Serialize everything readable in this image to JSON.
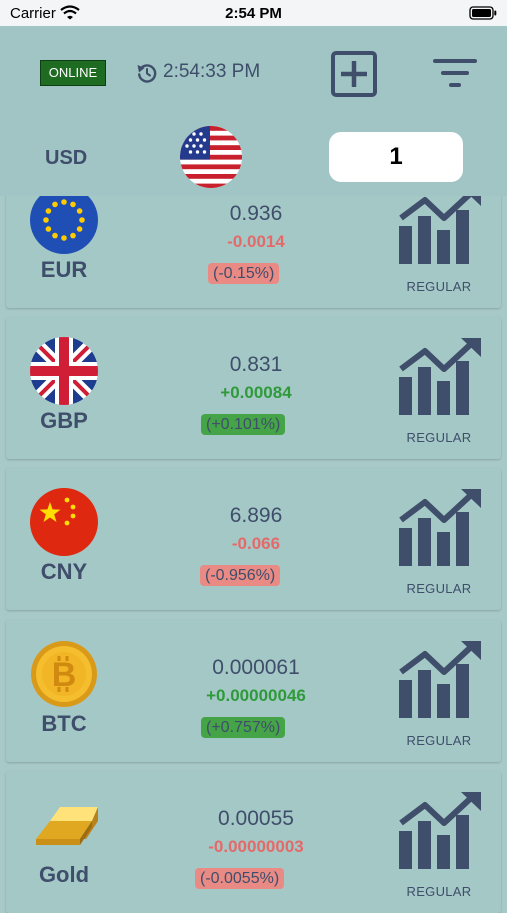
{
  "status_bar": {
    "carrier": "Carrier",
    "time": "2:54 PM"
  },
  "header": {
    "connection_status": "ONLINE",
    "last_updated": "2:54:33 PM",
    "base_currency": "USD",
    "amount": "1"
  },
  "currencies": [
    {
      "code": "EUR",
      "rate": "0.936",
      "change": "-0.0014",
      "percent": "(-0.15%)",
      "trend": "down",
      "mode": "REGULAR"
    },
    {
      "code": "GBP",
      "rate": "0.831",
      "change": "+0.00084",
      "percent": "(+0.101%)",
      "trend": "up",
      "mode": "REGULAR"
    },
    {
      "code": "CNY",
      "rate": "6.896",
      "change": "-0.066",
      "percent": "(-0.956%)",
      "trend": "down",
      "mode": "REGULAR"
    },
    {
      "code": "BTC",
      "rate": "0.000061",
      "change": "+0.00000046",
      "percent": "(+0.757%)",
      "trend": "up",
      "mode": "REGULAR"
    },
    {
      "code": "Gold",
      "rate": "0.00055",
      "change": "-0.00000003",
      "percent": "(-0.0055%)",
      "trend": "down",
      "mode": "REGULAR"
    }
  ],
  "colors": {
    "accent": "#3f4e6b",
    "background": "#a7c9c8",
    "negative": "#e46a6a",
    "positive": "#2e9a3a",
    "online": "#1e6b22"
  }
}
